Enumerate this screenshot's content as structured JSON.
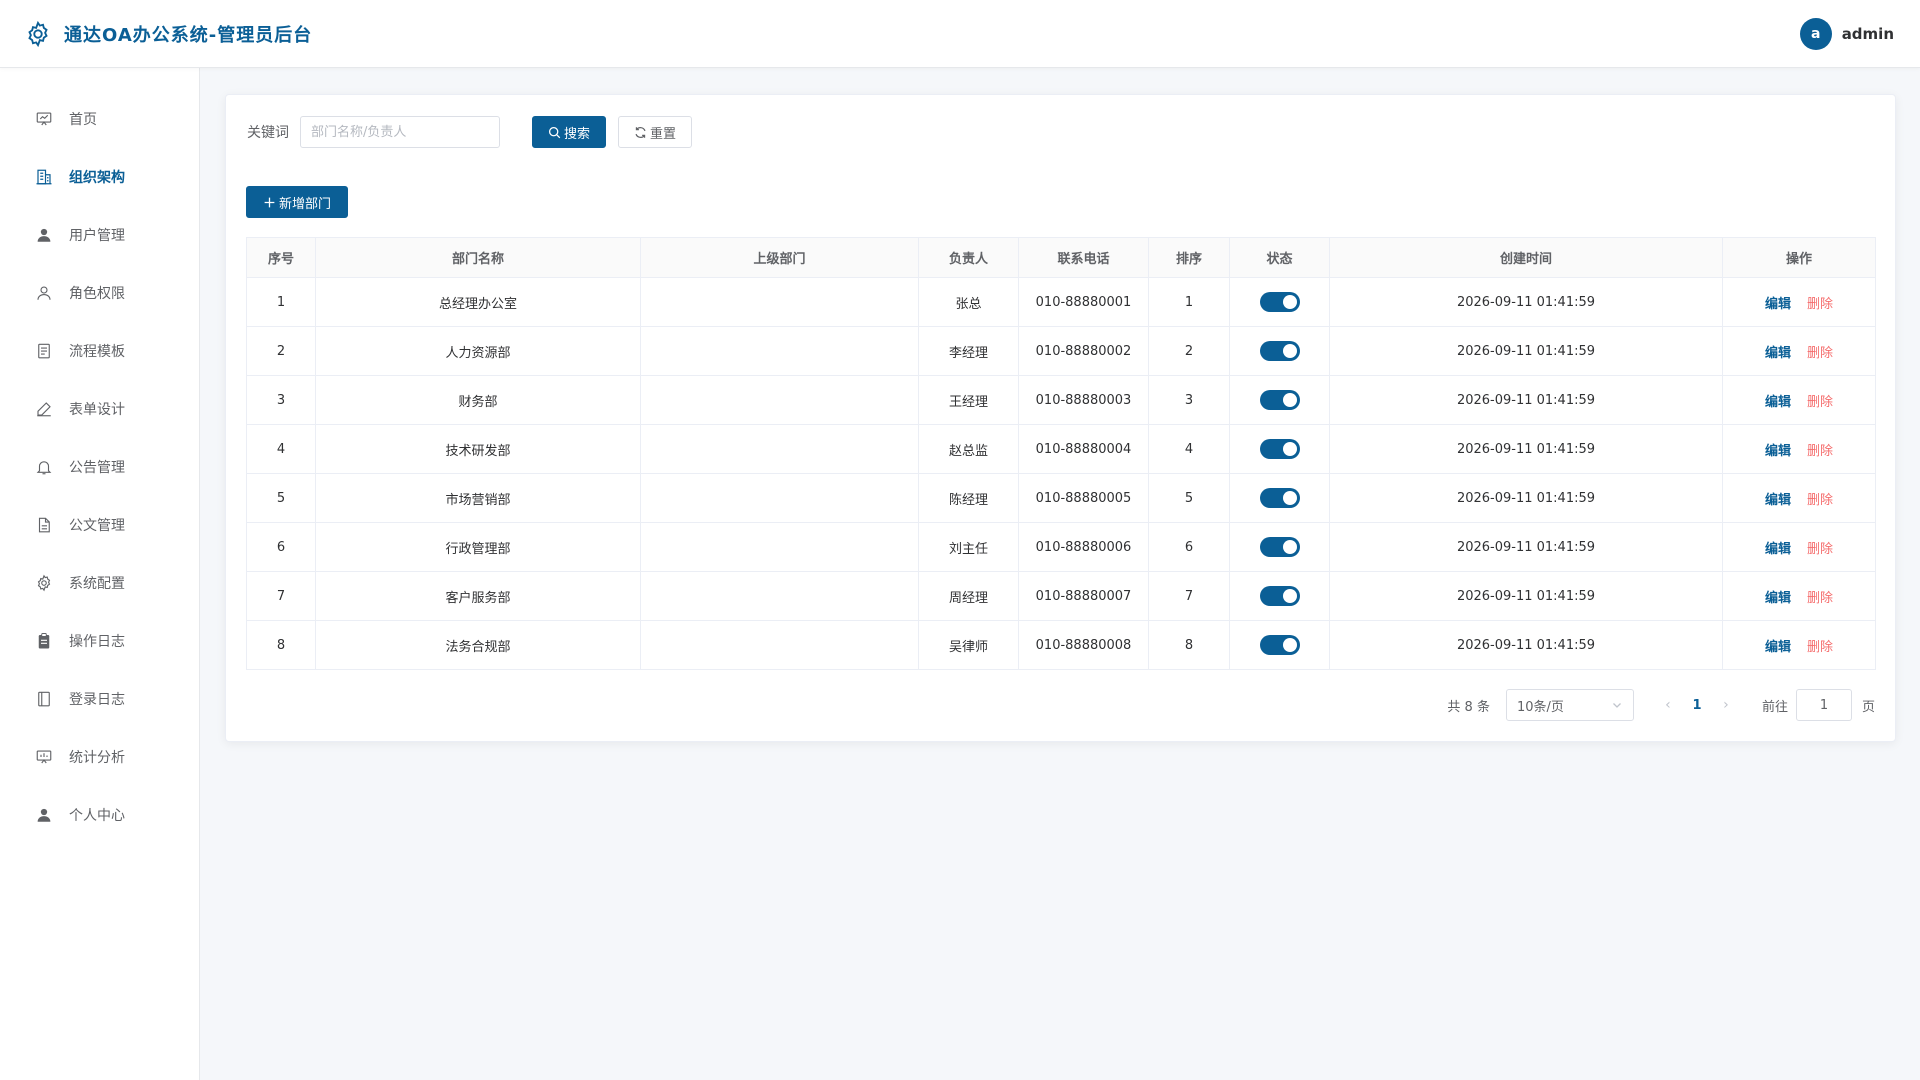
{
  "header": {
    "title": "通达OA办公系统-管理员后台",
    "avatar_letter": "a",
    "username": "admin",
    "brand_color": "#0b5f96"
  },
  "sidebar": {
    "items": [
      {
        "label": "首页",
        "icon": "dashboard-icon",
        "active": false
      },
      {
        "label": "组织架构",
        "icon": "building-icon",
        "active": true
      },
      {
        "label": "用户管理",
        "icon": "user-filled-icon",
        "active": false
      },
      {
        "label": "角色权限",
        "icon": "user-outline-icon",
        "active": false
      },
      {
        "label": "流程模板",
        "icon": "document-list-icon",
        "active": false
      },
      {
        "label": "表单设计",
        "icon": "edit-pen-icon",
        "active": false
      },
      {
        "label": "公告管理",
        "icon": "bell-icon",
        "active": false
      },
      {
        "label": "公文管理",
        "icon": "document-icon",
        "active": false
      },
      {
        "label": "系统配置",
        "icon": "gear-icon",
        "active": false
      },
      {
        "label": "操作日志",
        "icon": "clipboard-icon",
        "active": false
      },
      {
        "label": "登录日志",
        "icon": "notebook-icon",
        "active": false
      },
      {
        "label": "统计分析",
        "icon": "presentation-icon",
        "active": false
      },
      {
        "label": "个人中心",
        "icon": "user-filled-icon",
        "active": false
      }
    ]
  },
  "filter": {
    "label": "关键词",
    "placeholder": "部门名称/负责人",
    "value": "",
    "search_label": "搜索",
    "reset_label": "重置"
  },
  "toolbar": {
    "add_label": "新增部门"
  },
  "table": {
    "columns": [
      "序号",
      "部门名称",
      "上级部门",
      "负责人",
      "联系电话",
      "排序",
      "状态",
      "创建时间",
      "操作"
    ],
    "edit_label": "编辑",
    "delete_label": "删除",
    "rows": [
      {
        "index": "1",
        "name": "总经理办公室",
        "parent": "",
        "manager": "张总",
        "phone": "010-88880001",
        "sort": "1",
        "enabled": true,
        "created": "2026-09-11 01:41:59"
      },
      {
        "index": "2",
        "name": "人力资源部",
        "parent": "",
        "manager": "李经理",
        "phone": "010-88880002",
        "sort": "2",
        "enabled": true,
        "created": "2026-09-11 01:41:59"
      },
      {
        "index": "3",
        "name": "财务部",
        "parent": "",
        "manager": "王经理",
        "phone": "010-88880003",
        "sort": "3",
        "enabled": true,
        "created": "2026-09-11 01:41:59"
      },
      {
        "index": "4",
        "name": "技术研发部",
        "parent": "",
        "manager": "赵总监",
        "phone": "010-88880004",
        "sort": "4",
        "enabled": true,
        "created": "2026-09-11 01:41:59"
      },
      {
        "index": "5",
        "name": "市场营销部",
        "parent": "",
        "manager": "陈经理",
        "phone": "010-88880005",
        "sort": "5",
        "enabled": true,
        "created": "2026-09-11 01:41:59"
      },
      {
        "index": "6",
        "name": "行政管理部",
        "parent": "",
        "manager": "刘主任",
        "phone": "010-88880006",
        "sort": "6",
        "enabled": true,
        "created": "2026-09-11 01:41:59"
      },
      {
        "index": "7",
        "name": "客户服务部",
        "parent": "",
        "manager": "周经理",
        "phone": "010-88880007",
        "sort": "7",
        "enabled": true,
        "created": "2026-09-11 01:41:59"
      },
      {
        "index": "8",
        "name": "法务合规部",
        "parent": "",
        "manager": "吴律师",
        "phone": "010-88880008",
        "sort": "8",
        "enabled": true,
        "created": "2026-09-11 01:41:59"
      }
    ]
  },
  "pagination": {
    "total_text": "共 8 条",
    "page_size": "10条/页",
    "current_page": "1",
    "goto_label": "前往",
    "goto_value": "1",
    "page_suffix": "页"
  }
}
